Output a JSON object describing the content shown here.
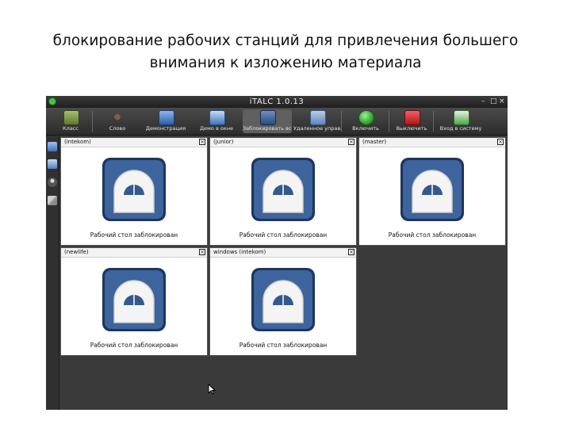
{
  "slide": {
    "title_line1": "блокирование рабочих станций для привлечения большего",
    "title_line2": "внимания к изложению материала"
  },
  "window": {
    "title": "iTALC 1.0.13",
    "controls": [
      "–",
      "□",
      "×"
    ]
  },
  "toolbar": {
    "buttons": [
      {
        "label": "Класс",
        "icon": "classroom-icon",
        "color": "#7a8f45"
      },
      {
        "label": "Слово",
        "icon": "spider-icon",
        "color": "#5a4a3a"
      },
      {
        "label": "Демонстрация",
        "icon": "overview-icon",
        "color": "#3a6fc0"
      },
      {
        "label": "Демо в окне",
        "icon": "window-demo-icon",
        "color": "#4a86c8"
      },
      {
        "label": "Заблокировать все",
        "icon": "lock-all-icon",
        "color": "#3c5a8a"
      },
      {
        "label": "Удаленное управление",
        "icon": "remote-control-icon",
        "color": "#6a8fc8"
      },
      {
        "label": "Включить",
        "icon": "power-on-icon",
        "color": "#3ab03a"
      },
      {
        "label": "Выключить",
        "icon": "power-off-icon",
        "color": "#d02a2a"
      },
      {
        "label": "Вход в систему",
        "icon": "login-icon",
        "color": "#49a84a"
      }
    ]
  },
  "sidebar": {
    "icons": [
      "home-icon",
      "snapshot-icon",
      "user-icon",
      "tools-icon"
    ]
  },
  "clients": [
    {
      "name": "(intekom)",
      "status": "Рабочий стол заблокирован"
    },
    {
      "name": "(junior)",
      "status": "Рабочий стол заблокирован"
    },
    {
      "name": "(master)",
      "status": "Рабочий стол заблокирован"
    },
    {
      "name": "(newlife)",
      "status": "Рабочий стол заблокирован"
    },
    {
      "name": "windows (intekom)",
      "status": "Рабочий стол заблокирован"
    }
  ],
  "close_glyph": "×",
  "colors": {
    "lock_blue": "#35598c",
    "lock_dark": "#1e3560",
    "desk_bg": "#3a3a3a",
    "title_bg": "#262626"
  }
}
